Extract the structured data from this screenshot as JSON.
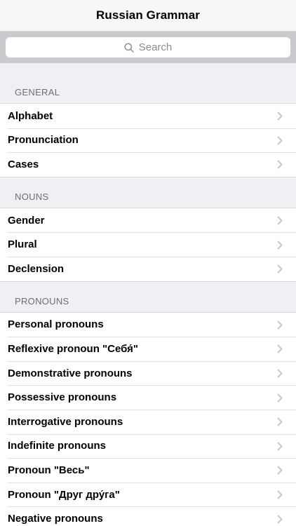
{
  "navbar": {
    "title": "Russian Grammar"
  },
  "search": {
    "placeholder": "Search"
  },
  "sections": [
    {
      "header": "GENERAL",
      "items": [
        "Alphabet",
        "Pronunciation",
        "Cases"
      ]
    },
    {
      "header": "NOUNS",
      "items": [
        "Gender",
        "Plural",
        "Declension"
      ]
    },
    {
      "header": "PRONOUNS",
      "items": [
        "Personal pronouns",
        "Reflexive pronoun \"Себя́\"",
        "Demonstrative pronouns",
        "Possessive pronouns",
        "Interrogative pronouns",
        "Indefinite pronouns",
        "Pronoun \"Весь\"",
        "Pronoun \"Друг дру́га\"",
        "Negative pronouns"
      ]
    }
  ],
  "icons": {
    "search": "search-icon",
    "disclosure": "chevron-right-icon"
  },
  "colors": {
    "header_text": "#6d6d72",
    "chevron": "#c7c7cc",
    "background": "#efeff4"
  }
}
